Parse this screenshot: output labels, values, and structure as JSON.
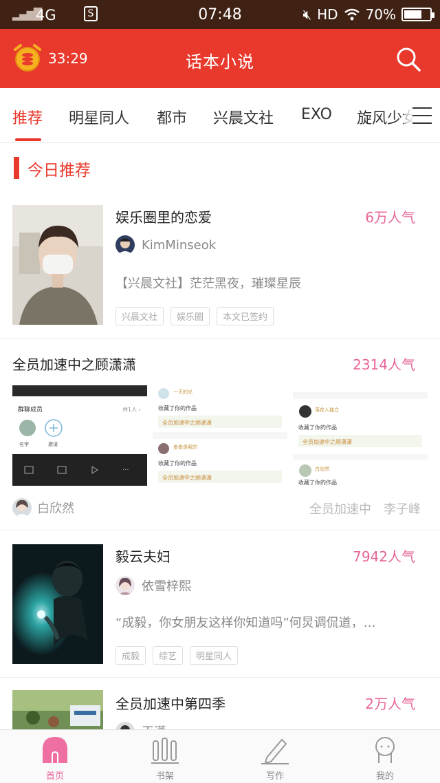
{
  "status_bar": {
    "network": "4G",
    "time": "07:48",
    "hd": "HD",
    "battery": "70%",
    "battery_level": 0.7
  },
  "header": {
    "timer": "33:29",
    "title": "话本小说"
  },
  "tabs": [
    {
      "label": "推荐",
      "active": true
    },
    {
      "label": "明星同人",
      "active": false
    },
    {
      "label": "都市",
      "active": false
    },
    {
      "label": "兴晨文社",
      "active": false
    },
    {
      "label": "EXO",
      "active": false
    },
    {
      "label": "旋风少女",
      "active": false
    }
  ],
  "section": {
    "title": "今日推荐"
  },
  "cards": [
    {
      "title": "娱乐圈里的恋爱",
      "popularity": "6万人气",
      "author": "KimMinseok",
      "description": "【兴晨文社】茫茫黑夜，璀璨星辰",
      "tags": [
        "兴晨文社",
        "娱乐圈",
        "本文已签约"
      ]
    },
    {
      "title": "全员加速中之顾潇潇",
      "popularity": "2314人气",
      "author": "白欣然",
      "tags": [
        "全员加速中",
        "李子峰"
      ],
      "screenshots": [
        {
          "header": "群聊成员",
          "count": "共1人",
          "name": "名字",
          "invite": "邀请"
        },
        {
          "name1": "一天的光",
          "line1": "收藏了你的作品",
          "link1": "全员加速中之顾潇潇",
          "name2": "墨墨是我的",
          "line2": "收藏了你的作品",
          "link2": "全员加速中之顾潇潇"
        },
        {
          "name1": "落花人独立",
          "line1": "收藏了你的作品",
          "link1": "全员加速中之顾潇潇",
          "name2": "白欣然",
          "line2": "收藏了你的作品"
        }
      ]
    },
    {
      "title": "毅云夫妇",
      "popularity": "7942人气",
      "author": "依雪梓熙",
      "description": "“成毅，你女朋友这样你知道吗”何炅调侃道，…",
      "tags": [
        "成毅",
        "综艺",
        "明星同人"
      ]
    },
    {
      "title": "全员加速中第四季",
      "popularity": "2万人气",
      "author": "玉潇"
    }
  ],
  "bottom_nav": [
    {
      "label": "首页",
      "icon": "home-icon",
      "active": true
    },
    {
      "label": "书架",
      "icon": "bookshelf-icon",
      "active": false
    },
    {
      "label": "写作",
      "icon": "pen-icon",
      "active": false
    },
    {
      "label": "我的",
      "icon": "profile-icon",
      "active": false
    }
  ],
  "colors": {
    "brand_red": "#e9392c",
    "popularity_pink": "#e7669a",
    "status_bar": "#3f2214"
  }
}
